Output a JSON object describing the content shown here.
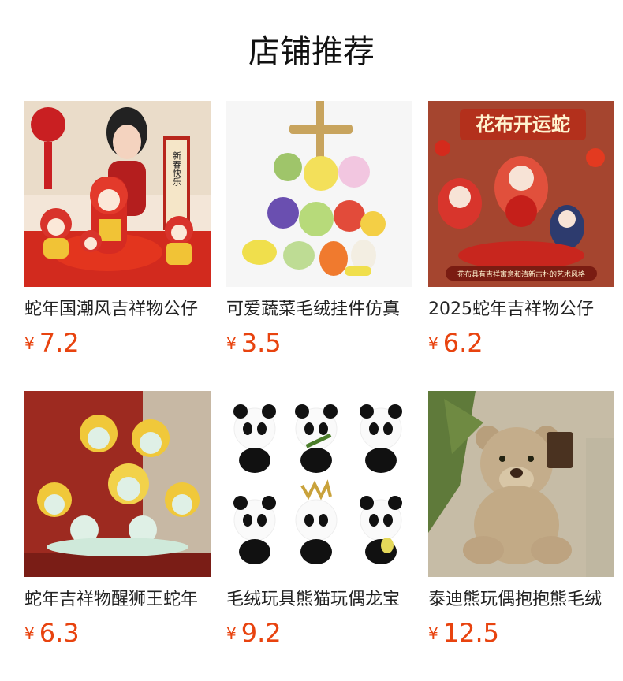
{
  "section": {
    "title": "店铺推荐"
  },
  "products": [
    {
      "title": "蛇年国潮风吉祥物公仔",
      "currency": "¥",
      "price": "7.2",
      "image_text": "新春快乐"
    },
    {
      "title": "可爱蔬菜毛绒挂件仿真",
      "currency": "¥",
      "price": "3.5"
    },
    {
      "title": "2025蛇年吉祥物公仔",
      "currency": "¥",
      "price": "6.2",
      "image_text": "花布开运蛇",
      "image_caption": "花布具有吉祥寓意和清新古朴的艺术风格"
    },
    {
      "title": "蛇年吉祥物醒狮王蛇年",
      "currency": "¥",
      "price": "6.3"
    },
    {
      "title": "毛绒玩具熊猫玩偶龙宝",
      "currency": "¥",
      "price": "9.2"
    },
    {
      "title": "泰迪熊玩偶抱抱熊毛绒",
      "currency": "¥",
      "price": "12.5"
    }
  ]
}
